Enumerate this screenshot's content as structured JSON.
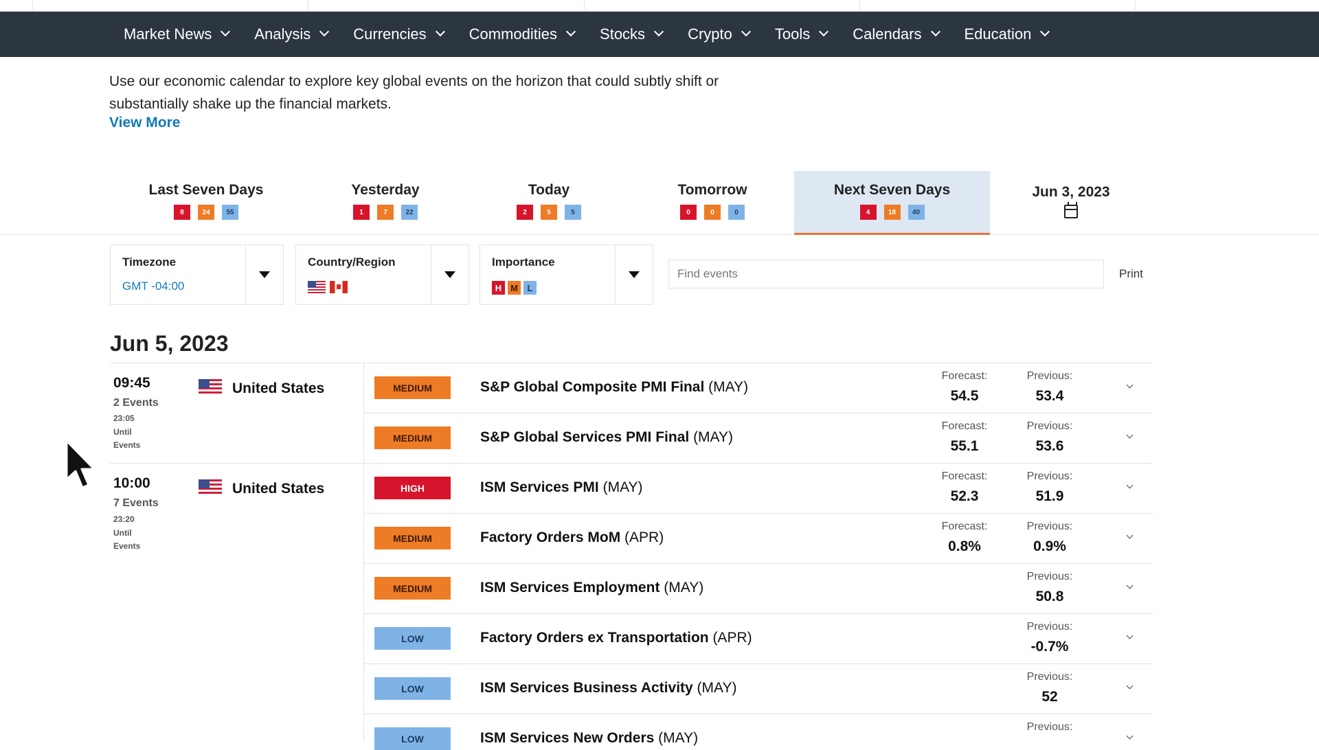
{
  "nav": {
    "items": [
      "Market News",
      "Analysis",
      "Currencies",
      "Commodities",
      "Stocks",
      "Crypto",
      "Tools",
      "Calendars",
      "Education"
    ]
  },
  "intro": {
    "text": "Use our economic calendar to explore key global events on the horizon that could subtly shift or substantially shake up the financial markets.",
    "view_more": "View More"
  },
  "tabs": [
    {
      "label": "Last Seven Days",
      "high": "8",
      "medium": "24",
      "low": "55"
    },
    {
      "label": "Yesterday",
      "high": "1",
      "medium": "7",
      "low": "22"
    },
    {
      "label": "Today",
      "high": "2",
      "medium": "5",
      "low": "5"
    },
    {
      "label": "Tomorrow",
      "high": "0",
      "medium": "0",
      "low": "0"
    },
    {
      "label": "Next Seven Days",
      "high": "4",
      "medium": "18",
      "low": "40",
      "active": true
    },
    {
      "label": "Jun 3, 2023"
    }
  ],
  "filters": {
    "timezone": {
      "label": "Timezone",
      "value": "GMT -04:00"
    },
    "country": {
      "label": "Country/Region"
    },
    "importance": {
      "label": "Importance",
      "levels": [
        "H",
        "M",
        "L"
      ]
    },
    "search_placeholder": "Find events",
    "print": "Print"
  },
  "date_heading": "Jun 5, 2023",
  "groups": [
    {
      "time": "09:45",
      "count": "2 Events",
      "until": "23:05 Until Events",
      "country": "United States"
    },
    {
      "time": "10:00",
      "count": "7 Events",
      "until": "23:20 Until Events",
      "country": "United States"
    }
  ],
  "events": [
    {
      "importance": "MEDIUM",
      "level": "medium",
      "name": "S&P Global Composite PMI Final",
      "period": " (MAY)",
      "forecast_label": "Forecast:",
      "forecast": "54.5",
      "previous_label": "Previous:",
      "previous": "53.4"
    },
    {
      "importance": "MEDIUM",
      "level": "medium",
      "name": "S&P Global Services PMI Final",
      "period": " (MAY)",
      "forecast_label": "Forecast:",
      "forecast": "55.1",
      "previous_label": "Previous:",
      "previous": "53.6"
    },
    {
      "importance": "HIGH",
      "level": "high",
      "name": "ISM Services PMI",
      "period": " (MAY)",
      "forecast_label": "Forecast:",
      "forecast": "52.3",
      "previous_label": "Previous:",
      "previous": "51.9"
    },
    {
      "importance": "MEDIUM",
      "level": "medium",
      "name": "Factory Orders MoM",
      "period": " (APR)",
      "forecast_label": "Forecast:",
      "forecast": "0.8%",
      "previous_label": "Previous:",
      "previous": "0.9%"
    },
    {
      "importance": "MEDIUM",
      "level": "medium",
      "name": "ISM Services Employment",
      "period": " (MAY)",
      "forecast_label": "",
      "forecast": "",
      "previous_label": "Previous:",
      "previous": "50.8"
    },
    {
      "importance": "LOW",
      "level": "low",
      "name": "Factory Orders ex Transportation",
      "period": " (APR)",
      "forecast_label": "",
      "forecast": "",
      "previous_label": "Previous:",
      "previous": "-0.7%"
    },
    {
      "importance": "LOW",
      "level": "low",
      "name": "ISM Services Business Activity",
      "period": " (MAY)",
      "forecast_label": "",
      "forecast": "",
      "previous_label": "Previous:",
      "previous": "52"
    },
    {
      "importance": "LOW",
      "level": "low",
      "name": "ISM Services New Orders",
      "period": " (MAY)",
      "forecast_label": "",
      "forecast": "",
      "previous_label": "Previous:",
      "previous": ""
    }
  ],
  "colors": {
    "nav_bg": "#2b3640",
    "high": "#d6142b",
    "medium": "#ee7b25",
    "low": "#7fb3e6",
    "link": "#1479b8",
    "active_tab_bg": "#dde8f2"
  }
}
